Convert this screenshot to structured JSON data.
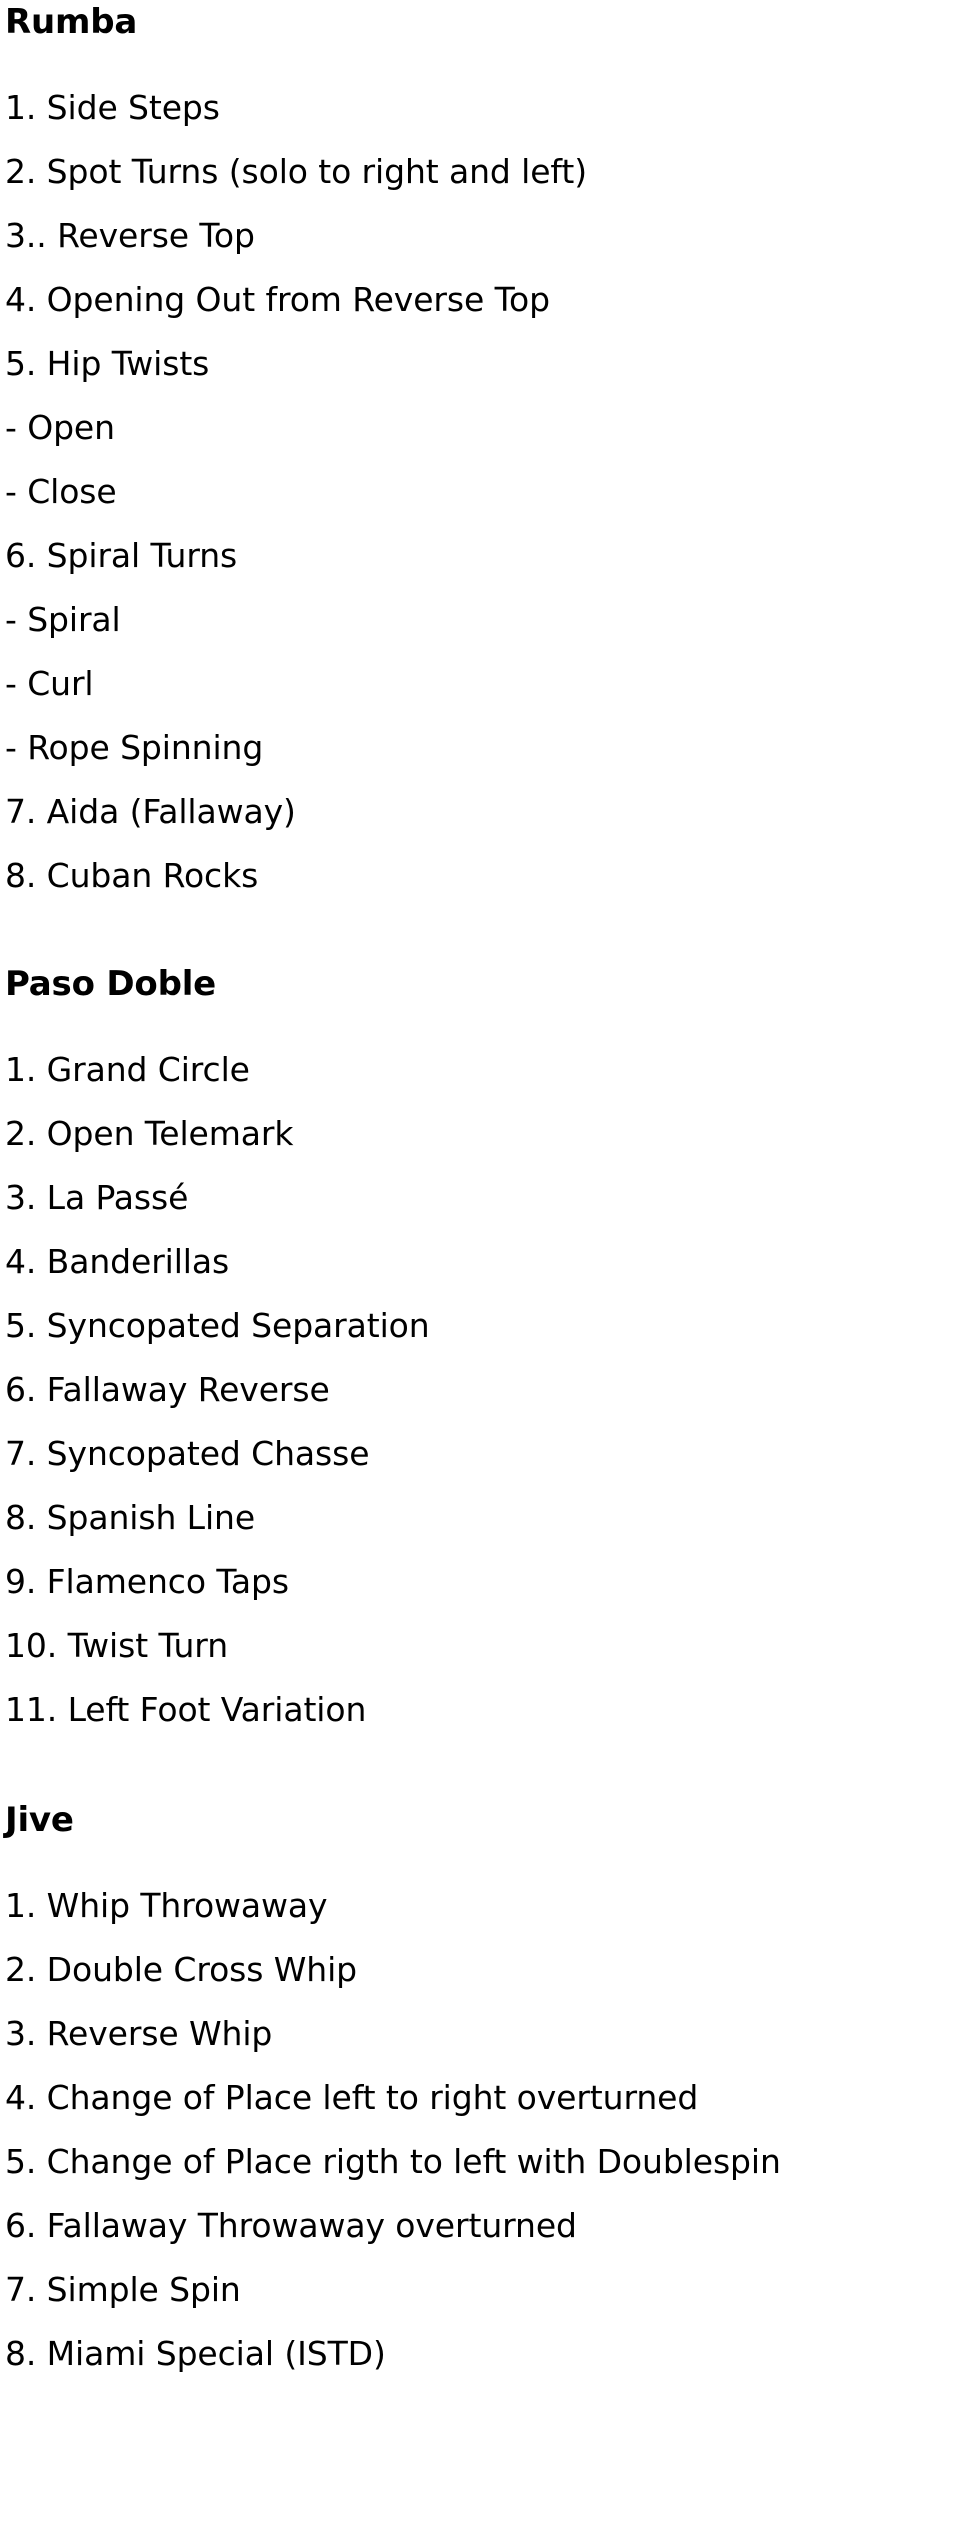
{
  "document": {
    "sections": [
      {
        "id": "rumba",
        "heading": "Rumba",
        "items": [
          "1. Side Steps",
          "2. Spot Turns (solo to right and left)",
          "3.. Reverse Top",
          "4. Opening Out from Reverse Top",
          "5. Hip Twists",
          "- Open",
          "- Close",
          "6. Spiral Turns",
          "- Spiral",
          "- Curl",
          "- Rope Spinning",
          "7. Aida (Fallaway)",
          "8. Cuban Rocks"
        ]
      },
      {
        "id": "paso-doble",
        "heading": "Paso Doble",
        "items": [
          "1. Grand Circle",
          "2. Open Telemark",
          "3. La Passé",
          "4. Banderillas",
          "5. Syncopated Separation",
          "6. Fallaway Reverse",
          "7. Syncopated Chasse",
          "8. Spanish Line",
          "9. Flamenco Taps",
          "10. Twist Turn",
          "11. Left Foot Variation"
        ]
      },
      {
        "id": "jive",
        "heading": "Jive",
        "items": [
          "1. Whip Throwaway",
          "2. Double Cross Whip",
          "3. Reverse Whip",
          "4. Change of Place left to right overturned",
          "5. Change of Place rigth to left with Doublespin",
          "6. Fallaway Throwaway overturned",
          "7. Simple Spin",
          "8. Miami Special (ISTD)"
        ]
      }
    ]
  }
}
